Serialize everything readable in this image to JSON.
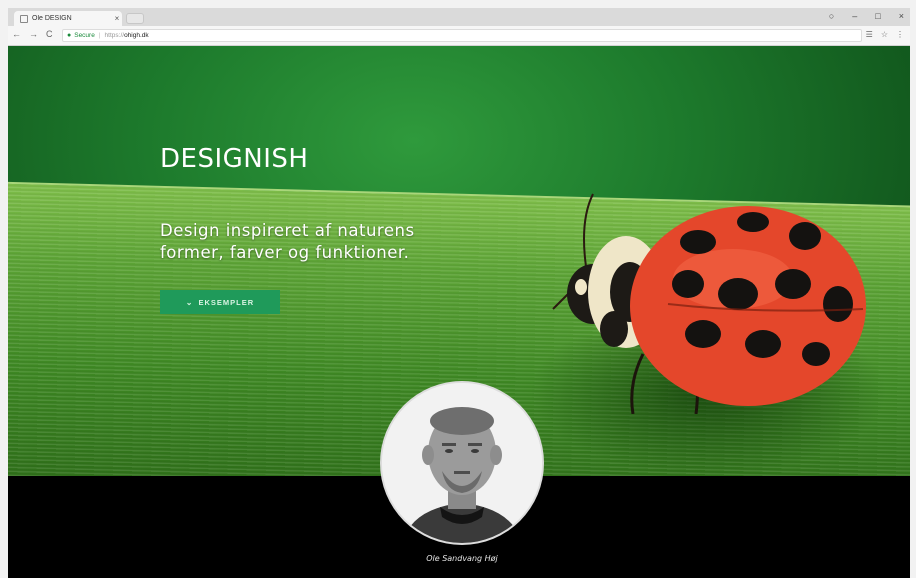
{
  "browser": {
    "tab_title": "Ole DESIGN",
    "tab_close": "×",
    "window_controls": {
      "account": "○",
      "minimize": "–",
      "maximize": "□",
      "close": "×"
    },
    "nav": {
      "back": "←",
      "forward": "→",
      "reload": "C"
    },
    "address": {
      "secure_label": "Secure",
      "protocol": "https://",
      "host": "ohigh.dk"
    },
    "toolbar_icons": {
      "extension": "☰",
      "star": "☆",
      "menu": "⋮"
    }
  },
  "hero": {
    "title": "DESIGNISH",
    "subtitle": "Design inspireret af naturens former, farver og funktioner.",
    "cta_icon": "chevron-down-icon",
    "cta_label": "EKSEMPLER"
  },
  "profile": {
    "name": "Ole Sandvang Høj"
  },
  "colors": {
    "accent": "#1f9a5a",
    "leaf_green": "#4f9a2e",
    "ladybug_red": "#e84a2a"
  }
}
